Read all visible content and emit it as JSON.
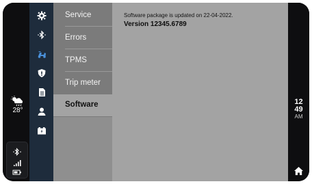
{
  "weather": {
    "icon": "partly-cloudy-rain-icon",
    "temperature": "28°"
  },
  "status_icons": [
    "bluetooth-icon",
    "signal-icon",
    "battery-icon"
  ],
  "nav_icons": [
    {
      "name": "settings-icon",
      "active": false
    },
    {
      "name": "bluetooth-icon",
      "active": false
    },
    {
      "name": "scooter-icon",
      "active": true
    },
    {
      "name": "shield-icon",
      "active": false
    },
    {
      "name": "document-icon",
      "active": false
    },
    {
      "name": "user-icon",
      "active": false
    },
    {
      "name": "battery-charge-icon",
      "active": false
    }
  ],
  "menu": {
    "items": [
      {
        "label": "Service"
      },
      {
        "label": "Errors"
      },
      {
        "label": "TPMS"
      },
      {
        "label": "Trip meter"
      },
      {
        "label": "Software"
      }
    ],
    "active": "Software"
  },
  "content": {
    "update_note": "Software package is updated on 22-04-2022.",
    "version": "Version 12345.6789"
  },
  "clock": {
    "hour": "12",
    "minute": "49",
    "ampm": "AM"
  },
  "colors": {
    "accent": "#4a90d9",
    "nav_bg": "#1e2c3c",
    "panel": "#a3a3a3"
  }
}
